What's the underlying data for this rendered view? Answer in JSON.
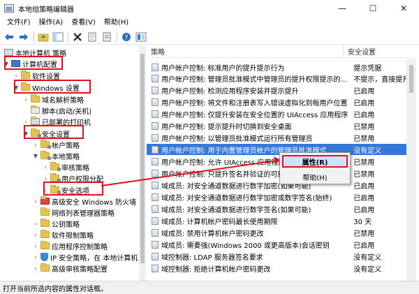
{
  "window": {
    "title": "本地组策略编辑器"
  },
  "menu": [
    "文件(F)",
    "操作(A)",
    "查看(V)",
    "帮助(H)"
  ],
  "tree": {
    "root": "本地计算机 策略",
    "computer_config": "计算机配置",
    "software_settings": "软件设置",
    "windows_settings": "Windows 设置",
    "dns": "域名解析策略",
    "scripts": "脚本(启动/关机)",
    "printers": "已部署的打印机",
    "security_settings": "安全设置",
    "account_policies": "帐户策略",
    "local_policies": "本地策略",
    "audit_policy": "审核策略",
    "user_rights": "用户权限分配",
    "security_options": "安全选项",
    "advanced_firewall": "高级安全 Windows 防火墙",
    "network_list": "网络列表管理器策略",
    "public_key": "公钥策略",
    "software_restriction": "软件限制策略",
    "app_control": "应用程序控制策略",
    "ip_security": "IP 安全策略，在 本地计算机",
    "advanced_audit": "高级审核策略配置"
  },
  "columns": {
    "policy": "策略",
    "setting": "安全设置"
  },
  "policies": [
    {
      "name": "用户帐户控制: 标准用户的提升提示行为",
      "value": "提示凭据"
    },
    {
      "name": "用户帐户控制: 管理员批准模式中管理员的提升权限提示的...",
      "value": "不提示，直接提升"
    },
    {
      "name": "用户帐户控制: 检测应用程序安装并提示提升",
      "value": "已启用"
    },
    {
      "name": "用户帐户控制: 将文件和注册表写入错误虚拟化到每用户位置",
      "value": "已启用"
    },
    {
      "name": "用户帐户控制: 仅提升安装在安全位置的 UIAccess 应用程序",
      "value": "已启用"
    },
    {
      "name": "用户帐户控制: 提示提升时切换到安全桌面",
      "value": "已禁用"
    },
    {
      "name": "用户帐户控制: 以管理员批准模式运行所有管理员",
      "value": "已禁用"
    },
    {
      "name": "用户帐户控制: 用于内置管理员帐户的管理员批准模式",
      "value": "没有定义"
    },
    {
      "name": "用户帐户控制: 允许 UIAccess 应用程序在不使用安全桌面...",
      "value": "已禁用"
    },
    {
      "name": "用户帐户控制: 只提升签名并验证的可执行文件",
      "value": "已禁用"
    },
    {
      "name": "域成员: 对安全通道数据进行数字加密(如果可能)",
      "value": "已启用"
    },
    {
      "name": "域成员: 对安全通道数据进行数字加密或数字签名(始终)",
      "value": "已启用"
    },
    {
      "name": "域成员: 对安全通道数据进行数字签名(如果可能)",
      "value": "已启用"
    },
    {
      "name": "域成员: 计算机帐户密码最长使用期限",
      "value": "30 天"
    },
    {
      "name": "域成员: 禁用计算机帐户密码更改",
      "value": "已禁用"
    },
    {
      "name": "域成员: 需要强(Windows 2000 或更高版本)会话密钥",
      "value": "已启用"
    },
    {
      "name": "域控制器: LDAP 服务器签名要求",
      "value": "没有定义"
    },
    {
      "name": "域控制器: 拒绝计算机帐户密码更改",
      "value": "没有定义"
    }
  ],
  "context_menu": {
    "properties": "属性(R)",
    "help": "帮助(H)"
  },
  "status": "打开当前所选内容的属性对话框。"
}
